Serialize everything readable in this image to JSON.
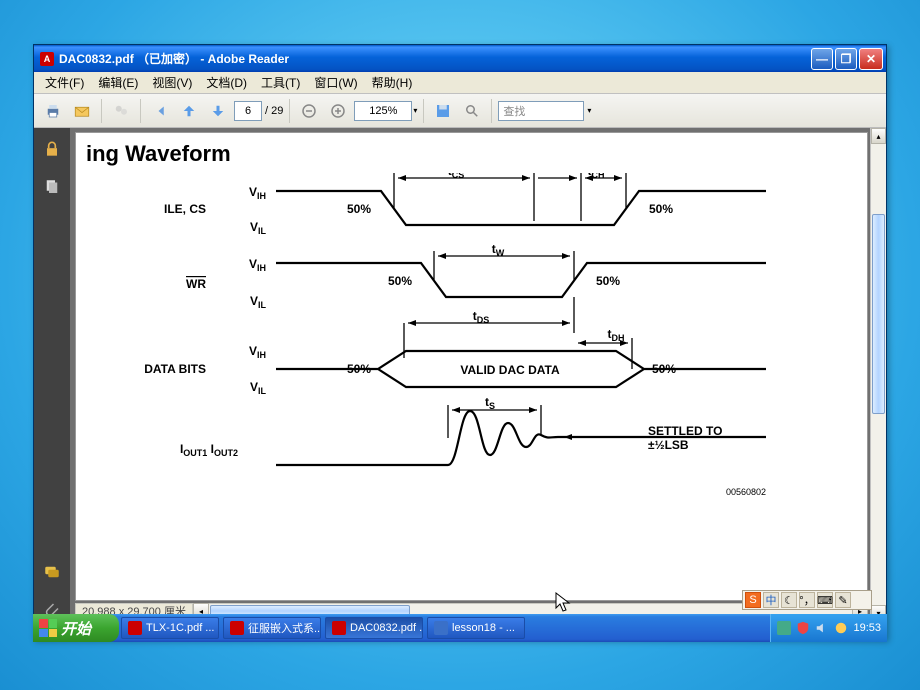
{
  "window": {
    "title": "DAC0832.pdf （已加密） - Adobe Reader"
  },
  "menu": {
    "file": "文件(F)",
    "edit": "编辑(E)",
    "view": "视图(V)",
    "doc": "文档(D)",
    "tool": "工具(T)",
    "win": "窗口(W)",
    "help": "帮助(H)"
  },
  "toolbar": {
    "page": "6",
    "pages": "/ 29",
    "zoom": "125%",
    "find": "查找"
  },
  "page": {
    "title": "ing Waveform",
    "labels": {
      "sig1": "ILE, CS",
      "sig2": "WR",
      "sig3": "DATA BITS",
      "sig4": "IOUT1 IOUT2",
      "vih": "VIH",
      "vil": "VIL",
      "p50": "50%",
      "tcs": "tCS",
      "tch": "tCH",
      "tw": "tW",
      "tds": "tDS",
      "tdh": "tDH",
      "ts": "tS",
      "valid": "VALID DAC DATA",
      "settle1": "SETTLED TO",
      "settle2": "±½LSB",
      "dsnum": "00560802"
    },
    "footer": "20.988 x 29.700 厘米"
  },
  "taskbar": {
    "start": "开始",
    "tasks": [
      {
        "label": "TLX-1C.pdf ...",
        "color": "#c00"
      },
      {
        "label": "征服嵌入式系...",
        "color": "#c00"
      },
      {
        "label": "DAC0832.pdf ...",
        "color": "#c00",
        "active": true
      },
      {
        "label": "lesson18 - ...",
        "color": "#3a70c8"
      }
    ],
    "clock": "19:53"
  },
  "ime": {
    "s": "S",
    "lang": "中"
  }
}
